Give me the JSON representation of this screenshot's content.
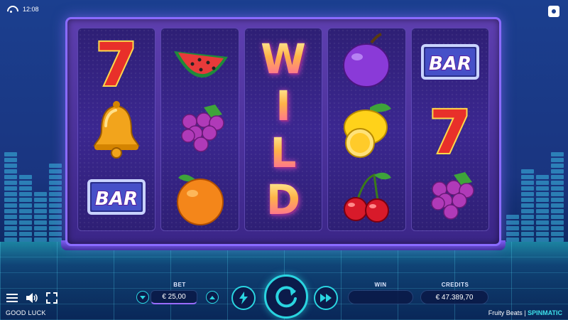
{
  "status": {
    "time": "12:08"
  },
  "reels": [
    [
      "seven-icon",
      "bell-icon",
      "bar-icon"
    ],
    [
      "watermelon-icon",
      "grapes-icon",
      "orange-icon"
    ],
    [
      "wild"
    ],
    [
      "plum-icon",
      "lemon-icon",
      "cherry-icon"
    ],
    [
      "bar-icon",
      "seven-icon",
      "grapes-icon"
    ]
  ],
  "wild_letters": [
    "W",
    "I",
    "L",
    "D"
  ],
  "bar_text": "BAR",
  "seven_text": "7",
  "controls": {
    "bet_label": "BET",
    "bet_value": "€ 25,00",
    "win_label": "WIN",
    "win_value": "",
    "credits_label": "CREDITS",
    "credits_value": "€ 47.389,70",
    "status_text": "GOOD LUCK",
    "game_name": "Fruity Beats",
    "separator": " | ",
    "provider": "SPINMATIC"
  },
  "colors": {
    "accent": "#2ad4e0",
    "frame": "#8a6bff",
    "background": "#1b3f8f"
  }
}
